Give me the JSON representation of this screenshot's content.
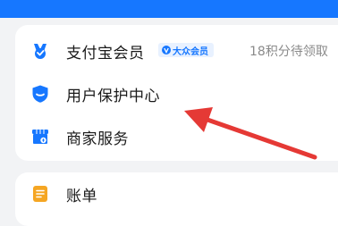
{
  "menu": {
    "items": [
      {
        "label": "支付宝会员",
        "icon": "member-v-icon",
        "badge": "大众会员",
        "right_text": "18积分待领取"
      },
      {
        "label": "用户保护中心",
        "icon": "shield-icon"
      },
      {
        "label": "商家服务",
        "icon": "store-icon"
      }
    ]
  },
  "bills": {
    "label": "账单",
    "icon": "bill-icon"
  },
  "colors": {
    "brand_blue": "#1677ff",
    "annotation_red": "#e53935",
    "bill_orange": "#f5a623"
  }
}
